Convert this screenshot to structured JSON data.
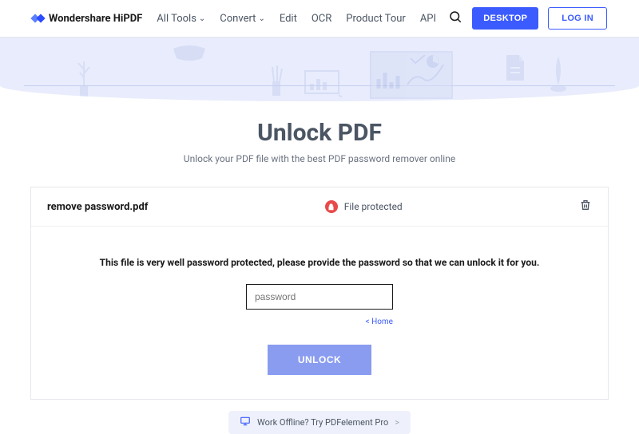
{
  "brand": "Wondershare HiPDF",
  "nav": {
    "all_tools": "All Tools",
    "convert": "Convert",
    "edit": "Edit",
    "ocr": "OCR",
    "product_tour": "Product Tour",
    "api": "API"
  },
  "buttons": {
    "desktop": "DESKTOP",
    "login": "LOG IN",
    "unlock": "UNLOCK"
  },
  "page": {
    "title": "Unlock PDF",
    "subtitle": "Unlock your PDF file with the best PDF password remover online"
  },
  "file": {
    "name": "remove password.pdf",
    "status": "File protected"
  },
  "form": {
    "instruction": "This file is very well password protected, please provide the password so that we can unlock it for you.",
    "placeholder": "password",
    "home_link": "< Home"
  },
  "promo": {
    "text": "Work Offline? Try PDFelement Pro",
    "chev": ">"
  }
}
